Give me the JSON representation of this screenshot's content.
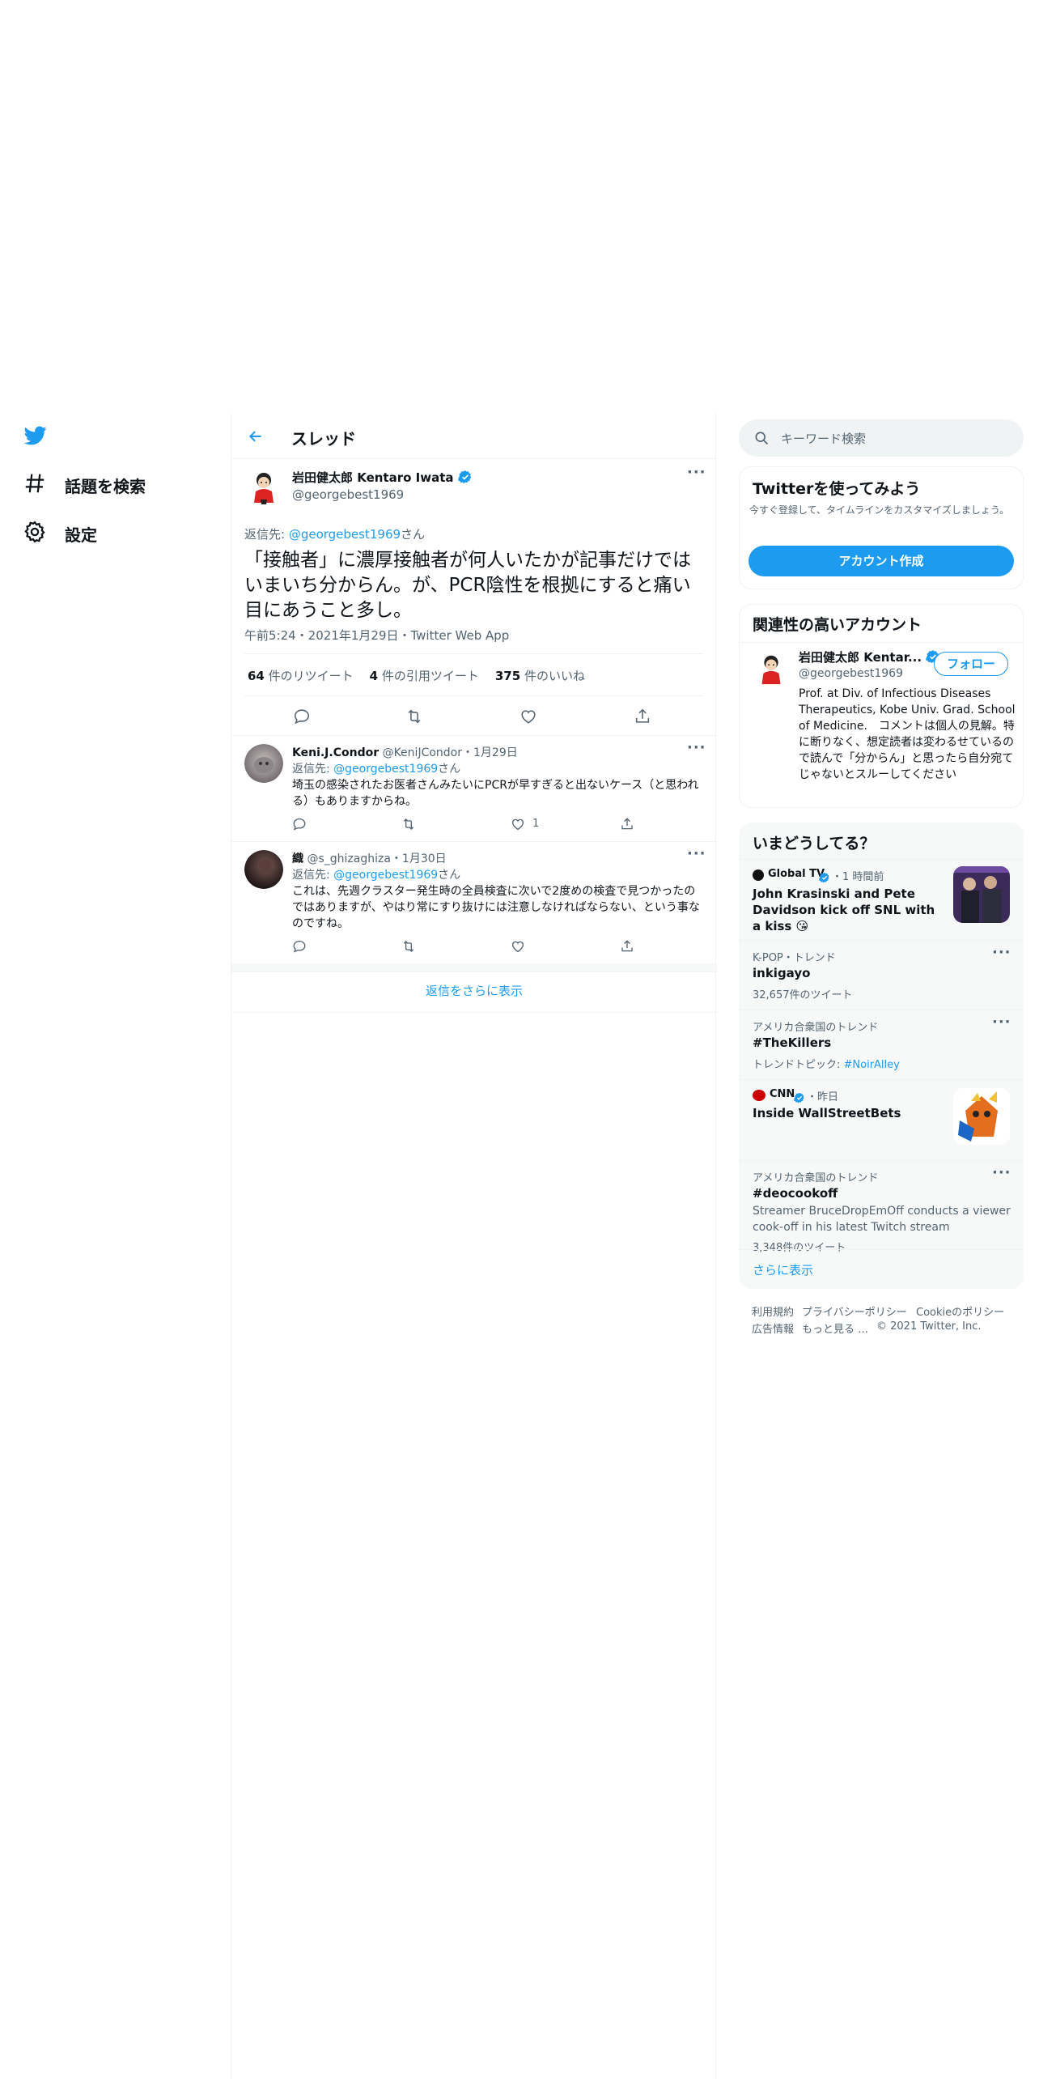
{
  "nav": {
    "explore_label": "話題を検索",
    "settings_label": "設定"
  },
  "thread": {
    "header_title": "スレッド",
    "main_tweet": {
      "display_name": "岩田健太郎 Kentaro Iwata",
      "handle": "@georgebest1969",
      "reply_to_prefix": "返信先: ",
      "reply_to_handle": "@georgebest1969",
      "reply_to_suffix": "さん",
      "text": "「接触者」に濃厚接触者が何人いたかが記事だけではいまいち分からん。が、PCR陰性を根拠にすると痛い目にあうこと多し。",
      "timestamp": "午前5:24・2021年1月29日・Twitter Web App",
      "retweets_count": "64",
      "retweets_label": " 件のリツイート",
      "quotes_count": "4",
      "quotes_label": " 件の引用ツイート",
      "likes_count": "375",
      "likes_label": " 件のいいね"
    },
    "replies": [
      {
        "display_name": "Keni.J.Condor",
        "handle": "@KeniJCondor",
        "date": "・1月29日",
        "reply_to_prefix": "返信先: ",
        "reply_to_handle": "@georgebest1969",
        "reply_to_suffix": "さん",
        "text": "埼玉の感染されたお医者さんみたいにPCRが早すぎると出ないケース（と思われる）もありますからね。",
        "like_count": "1"
      },
      {
        "display_name": "織",
        "handle": "@s_ghizaghiza",
        "date": "・1月30日",
        "reply_to_prefix": "返信先: ",
        "reply_to_handle": "@georgebest1969",
        "reply_to_suffix": "さん",
        "text": "これは、先週クラスター発生時の全員検査に次いで2度めの検査で見つかったのではありますが、やはり常にすり抜けには注意しなければならない、という事なのですね。",
        "like_count": ""
      }
    ],
    "show_more_replies": "返信をさらに表示"
  },
  "sidebar": {
    "search_placeholder": "キーワード検索",
    "signup": {
      "title": "Twitterを使ってみよう",
      "description": "今すぐ登録して、タイムラインをカスタマイズしましょう。",
      "button_label": "アカウント作成"
    },
    "related": {
      "title": "関連性の高いアカウント",
      "display_name": "岩田健太郎 Kentar...",
      "handle": "@georgebest1969",
      "follow_label": "フォロー",
      "bio": "Prof. at Div. of Infectious Diseases Therapeutics, Kobe Univ. Grad. School of Medicine.　コメントは個人の見解。特に断りなく、想定読者は変わるせているので読んで「分からん」と思ったら自分宛てじゃないとスルーしてください"
    },
    "trends": {
      "title": "いまどうしてる？",
      "items": [
        {
          "source": "Global TV",
          "meta": "・1 時間前",
          "headline": "John Krasinski and Pete Davidson kick off SNL with a kiss 😘"
        },
        {
          "meta": "K-POP・トレンド",
          "name": "inkigayo",
          "count": "32,657件のツイート"
        },
        {
          "meta": "アメリカ合衆国のトレンド",
          "name": "#TheKillers",
          "topic_prefix": "トレンドトピック: ",
          "topic": "#NoirAlley"
        },
        {
          "source": "CNN",
          "meta": "・昨日",
          "headline": "Inside WallStreetBets"
        },
        {
          "meta": "アメリカ合衆国のトレンド",
          "name": "#deocookoff",
          "desc": "Streamer BruceDropEmOff conducts a viewer cook-off in his latest Twitch stream",
          "count": "3,348件のツイート"
        }
      ],
      "show_more": "さらに表示"
    },
    "footer": {
      "terms": "利用規約",
      "privacy": "プライバシーポリシー",
      "cookie": "Cookieのポリシー",
      "ads": "広告情報",
      "more": "もっと見る …",
      "copyright": "© 2021 Twitter, Inc."
    }
  },
  "colors": {
    "accent": "#1d9bf0",
    "text": "#0f1419",
    "muted": "#536471",
    "border": "#eff3f4",
    "card_gray": "#f7f9f9"
  }
}
